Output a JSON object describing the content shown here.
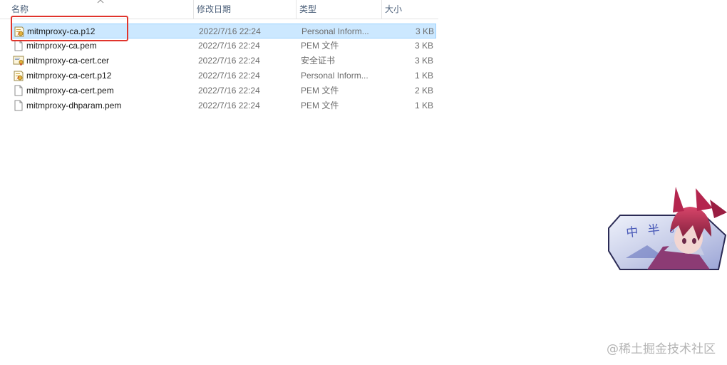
{
  "columns": {
    "name": "名称",
    "date": "修改日期",
    "type": "类型",
    "size": "大小"
  },
  "files": [
    {
      "name": "mitmproxy-ca.p12",
      "date": "2022/7/16 22:24",
      "type": "Personal Inform...",
      "size": "3 KB",
      "icon": "certificate-package-icon",
      "selected": true
    },
    {
      "name": "mitmproxy-ca.pem",
      "date": "2022/7/16 22:24",
      "type": "PEM 文件",
      "size": "3 KB",
      "icon": "blank-file-icon",
      "selected": false
    },
    {
      "name": "mitmproxy-ca-cert.cer",
      "date": "2022/7/16 22:24",
      "type": "安全证书",
      "size": "3 KB",
      "icon": "security-certificate-icon",
      "selected": false
    },
    {
      "name": "mitmproxy-ca-cert.p12",
      "date": "2022/7/16 22:24",
      "type": "Personal Inform...",
      "size": "1 KB",
      "icon": "certificate-package-icon",
      "selected": false
    },
    {
      "name": "mitmproxy-ca-cert.pem",
      "date": "2022/7/16 22:24",
      "type": "PEM 文件",
      "size": "2 KB",
      "icon": "blank-file-icon",
      "selected": false
    },
    {
      "name": "mitmproxy-dhparam.pem",
      "date": "2022/7/16 22:24",
      "type": "PEM 文件",
      "size": "1 KB",
      "icon": "blank-file-icon",
      "selected": false
    }
  ],
  "sticker": {
    "text": "中 半 。"
  },
  "watermark": "@稀土掘金技术社区",
  "colors": {
    "selection_bg": "#cce8ff",
    "selection_border": "#99d1ff",
    "highlight_box": "#e0342c",
    "header_text": "#4c607a"
  }
}
